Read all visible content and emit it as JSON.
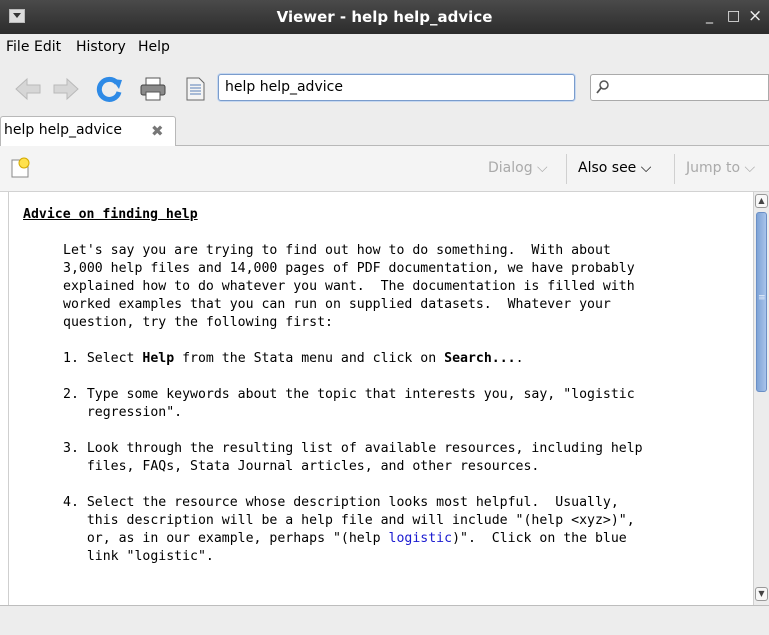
{
  "window": {
    "title": "Viewer - help help_advice",
    "minimize": "_",
    "maximize": "□",
    "close": "×"
  },
  "menu": [
    "File",
    "Edit",
    "History",
    "Help"
  ],
  "toolbar": {
    "url_value": "help help_advice",
    "search_value": "",
    "icons": [
      "back-arrow-icon",
      "forward-arrow-icon",
      "refresh-icon",
      "print-icon",
      "page-icon",
      "search-icon"
    ]
  },
  "tab": {
    "label": "help help_advice",
    "close": "✖"
  },
  "viewbar": {
    "dialog": "Dialog",
    "also_see": "Also see",
    "jump_to": "Jump to"
  },
  "doc": {
    "heading": "Advice on finding help",
    "intro": "Let's say you are trying to find out how to do something.  With about\n3,000 help files and 14,000 pages of PDF documentation, we have probably\nexplained how to do whatever you want.  The documentation is filled with\nworked examples that you can run on supplied datasets.  Whatever your\nquestion, try the following first:",
    "step1_a": "1. Select ",
    "step1_help": "Help",
    "step1_b": " from the Stata menu and click on ",
    "step1_search": "Search...",
    "step1_c": ".",
    "step2": "2. Type some keywords about the topic that interests you, say, \"logistic\n   regression\".",
    "step3": "3. Look through the resulting list of available resources, including help\n   files, FAQs, Stata Journal articles, and other resources.",
    "step4_a": "4. Select the resource whose description looks most helpful.  Usually,\n   this description will be a help file and will include \"(help <xyz>)\",\n   or, as in our example, perhaps \"(help ",
    "step4_link": "logistic",
    "step4_b": ")\".  Click on the blue\n   link \"logistic\"."
  },
  "colors": {
    "titlebar": "#2c2c2c",
    "link": "#1a1ad0",
    "refresh": "#2e8ae6"
  }
}
